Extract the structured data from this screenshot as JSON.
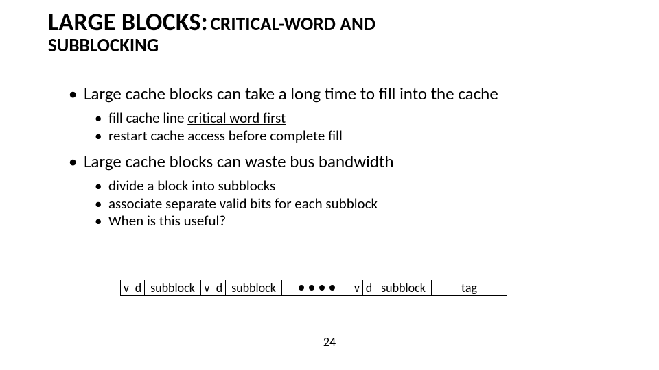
{
  "title": {
    "large": "LARGE BLOCKS:",
    "small": "CRITICAL-WORD AND",
    "line2": "SUBBLOCKING"
  },
  "bullets": {
    "b1a": "Large cache blocks can take a long time to fill into the cache",
    "b1a_sub1_pre": "fill cache line ",
    "b1a_sub1_ud": "critical word first",
    "b1a_sub2": "restart cache access before complete fill",
    "b1b": "Large cache blocks can waste bus bandwidth",
    "b1b_sub1": "divide a block into subblocks",
    "b1b_sub2": "associate separate valid bits for each subblock",
    "b1b_sub3": "When is this useful?"
  },
  "diagram": {
    "v": "v",
    "d": "d",
    "subblock": "subblock",
    "tag": "tag"
  },
  "page": "24"
}
